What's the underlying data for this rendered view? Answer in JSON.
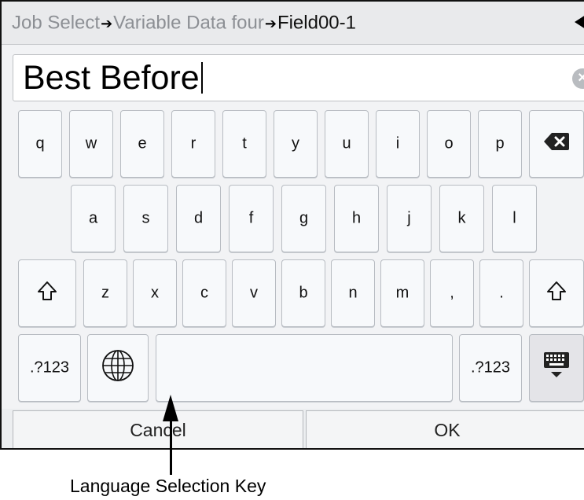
{
  "breadcrumb": {
    "item1": "Job Select",
    "separator1": "➔",
    "item2": "Variable Data four",
    "separator2": "➔",
    "current": "Field00-1"
  },
  "text_input": {
    "value": "Best Before"
  },
  "keyboard": {
    "row1": [
      "q",
      "w",
      "e",
      "r",
      "t",
      "y",
      "u",
      "i",
      "o",
      "p"
    ],
    "row2": [
      "a",
      "s",
      "d",
      "f",
      "g",
      "h",
      "j",
      "k",
      "l"
    ],
    "row3": [
      "z",
      "x",
      "c",
      "v",
      "b",
      "n",
      "m",
      ",",
      "."
    ],
    "symbols_left": ".?123",
    "symbols_right": ".?123"
  },
  "buttons": {
    "cancel": "Cancel",
    "ok": "OK"
  },
  "annotation": {
    "callout_text": "Language Selection Key"
  },
  "icons": [
    "back-arrow-icon",
    "clear-text-icon",
    "backspace-icon",
    "shift-icon",
    "globe-icon",
    "keyboard-hide-icon"
  ]
}
